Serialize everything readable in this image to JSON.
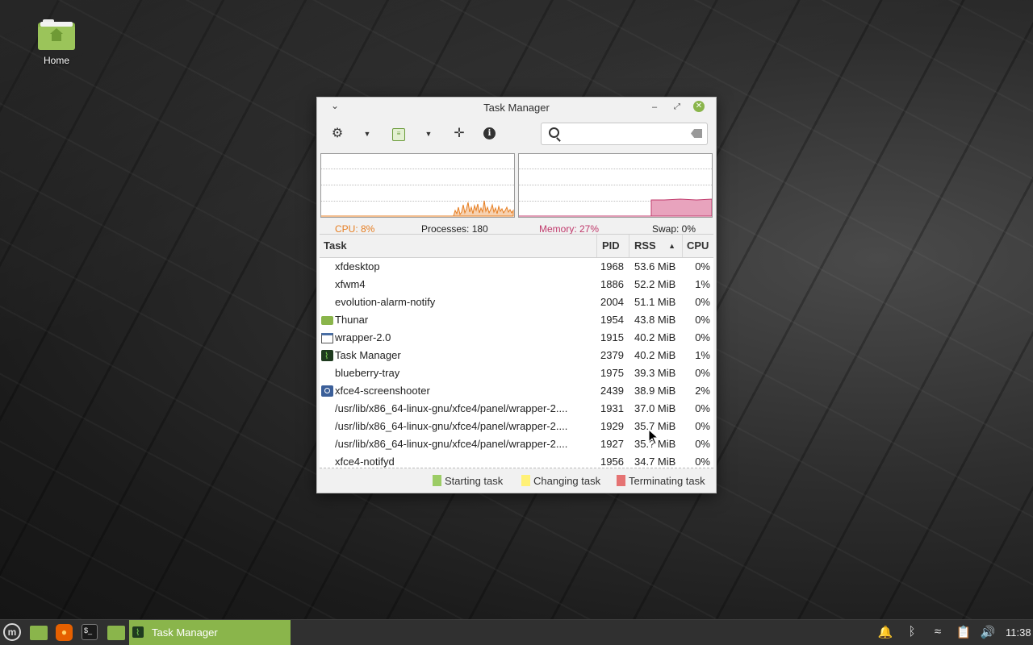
{
  "desktop": {
    "icons": [
      {
        "label": "Home"
      }
    ]
  },
  "window": {
    "title": "Task Manager",
    "search": {
      "value": "",
      "placeholder": ""
    },
    "stats": {
      "cpu": "CPU: 8%",
      "processes": "Processes: 180",
      "memory": "Memory: 27%",
      "swap": "Swap: 0%"
    },
    "columns": {
      "task": "Task",
      "pid": "PID",
      "rss": "RSS",
      "cpu": "CPU"
    },
    "rows": [
      {
        "icon": "none",
        "task": "xfdesktop",
        "pid": "1968",
        "rss": "53.6 MiB",
        "cpu": "0%"
      },
      {
        "icon": "none",
        "task": "xfwm4",
        "pid": "1886",
        "rss": "52.2 MiB",
        "cpu": "1%"
      },
      {
        "icon": "none",
        "task": "evolution-alarm-notify",
        "pid": "2004",
        "rss": "51.1 MiB",
        "cpu": "0%"
      },
      {
        "icon": "folder-icon",
        "task": "Thunar",
        "pid": "1954",
        "rss": "43.8 MiB",
        "cpu": "0%"
      },
      {
        "icon": "window-icon",
        "task": "wrapper-2.0",
        "pid": "1915",
        "rss": "40.2 MiB",
        "cpu": "0%"
      },
      {
        "icon": "task-manager-icon",
        "task": "Task Manager",
        "pid": "2379",
        "rss": "40.2 MiB",
        "cpu": "1%"
      },
      {
        "icon": "none",
        "task": "blueberry-tray",
        "pid": "1975",
        "rss": "39.3 MiB",
        "cpu": "0%"
      },
      {
        "icon": "camera-icon",
        "task": "xfce4-screenshooter",
        "pid": "2439",
        "rss": "38.9 MiB",
        "cpu": "2%"
      },
      {
        "icon": "none",
        "task": "/usr/lib/x86_64-linux-gnu/xfce4/panel/wrapper-2....",
        "pid": "1931",
        "rss": "37.0 MiB",
        "cpu": "0%"
      },
      {
        "icon": "none",
        "task": "/usr/lib/x86_64-linux-gnu/xfce4/panel/wrapper-2....",
        "pid": "1929",
        "rss": "35.7 MiB",
        "cpu": "0%"
      },
      {
        "icon": "none",
        "task": "/usr/lib/x86_64-linux-gnu/xfce4/panel/wrapper-2....",
        "pid": "1927",
        "rss": "35.? MiB",
        "cpu": "0%"
      },
      {
        "icon": "none",
        "task": "xfce4-notifyd",
        "pid": "1956",
        "rss": "34.7 MiB",
        "cpu": "0%"
      }
    ],
    "legend": {
      "starting": "Starting task",
      "changing": "Changing task",
      "terminating": "Terminating task"
    },
    "colors": {
      "cpu": "#e67e22",
      "memory": "#c0396b",
      "starting": "#9ccc65",
      "changing": "#fff176",
      "terminating": "#e57373",
      "accent": "#8ab54b"
    }
  },
  "taskbar": {
    "active_window": "Task Manager",
    "clock": "11:38"
  }
}
